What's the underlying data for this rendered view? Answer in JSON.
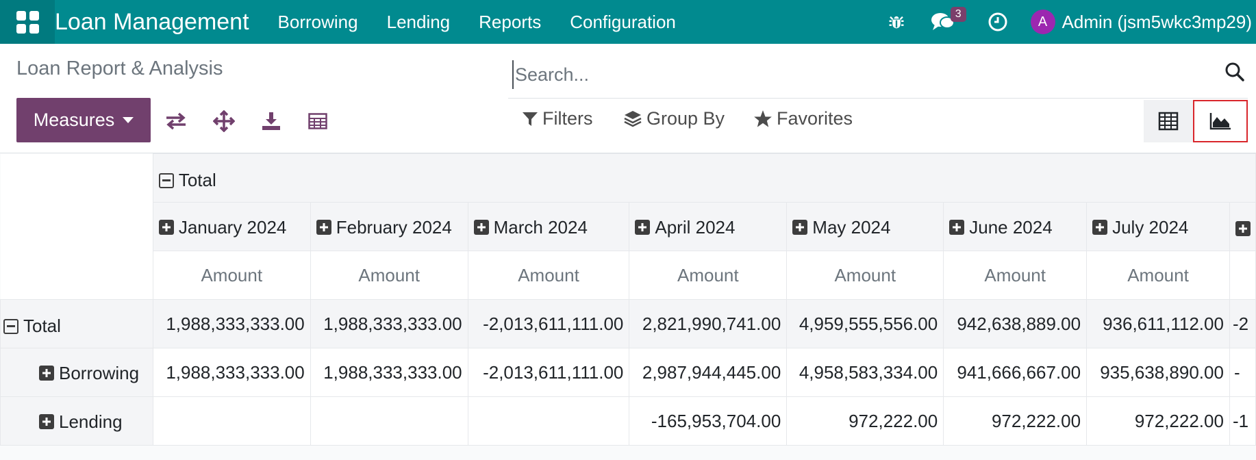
{
  "navbar": {
    "brand": "Loan Management",
    "menu": [
      "Borrowing",
      "Lending",
      "Reports",
      "Configuration"
    ],
    "messages_badge": "3",
    "user_initial": "A",
    "user_name": "Admin (jsm5wkc3mp29)"
  },
  "control": {
    "title": "Loan Report & Analysis",
    "search_placeholder": "Search...",
    "measures_label": "Measures",
    "filters_label": "Filters",
    "group_by_label": "Group By",
    "favorites_label": "Favorites"
  },
  "pivot": {
    "col_total_label": "Total",
    "months": [
      "January 2024",
      "February 2024",
      "March 2024",
      "April 2024",
      "May 2024",
      "June 2024",
      "July 2024",
      ""
    ],
    "measure_label": "Amount",
    "rows": [
      {
        "label": "Total",
        "values": [
          "1,988,333,333.00",
          "1,988,333,333.00",
          "-2,013,611,111.00",
          "2,821,990,741.00",
          "4,959,555,556.00",
          "942,638,889.00",
          "936,611,112.00",
          "-2"
        ]
      },
      {
        "label": "Borrowing",
        "values": [
          "1,988,333,333.00",
          "1,988,333,333.00",
          "-2,013,611,111.00",
          "2,987,944,445.00",
          "4,958,583,334.00",
          "941,666,667.00",
          "935,638,890.00",
          "-"
        ]
      },
      {
        "label": "Lending",
        "values": [
          "",
          "",
          "",
          "-165,953,704.00",
          "972,222.00",
          "972,222.00",
          "972,222.00",
          "-1"
        ]
      }
    ]
  },
  "colors": {
    "navbar": "#018a8f",
    "primary": "#71406d",
    "highlight": "#d9262b"
  }
}
